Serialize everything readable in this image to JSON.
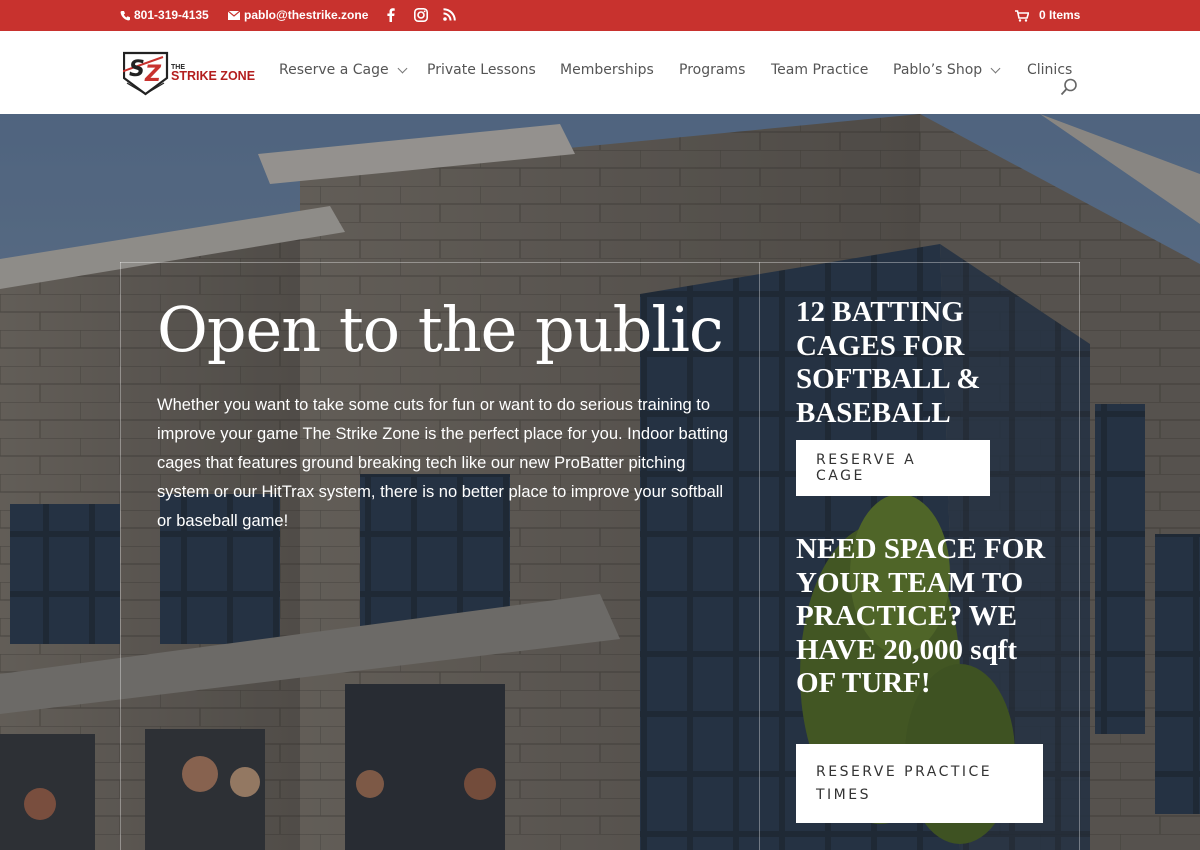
{
  "topbar": {
    "phone": "801-319-4135",
    "email": "pablo@thestrike.zone",
    "cart": "0 Items",
    "social_icons": [
      "facebook-icon",
      "instagram-icon",
      "rss-icon"
    ]
  },
  "logo": {
    "monogram": "SZ",
    "line1": "THE",
    "line2": "STRIKE ZONE"
  },
  "nav": {
    "items": [
      {
        "label": "Reserve a Cage",
        "dropdown": true
      },
      {
        "label": "Private Lessons",
        "dropdown": false
      },
      {
        "label": "Memberships",
        "dropdown": false
      },
      {
        "label": "Programs",
        "dropdown": false
      },
      {
        "label": "Team Practice",
        "dropdown": false
      },
      {
        "label": "Pablo’s Shop",
        "dropdown": true
      },
      {
        "label": "Clinics",
        "dropdown": false
      }
    ]
  },
  "hero": {
    "headline": "Open to the public",
    "body": "Whether you want to take some cuts for fun or want to do serious training to improve your game The Strike Zone is the perfect place for you. Indoor batting cages that features ground breaking tech like our new ProBatter pitching system or our HitTrax system, there is no better place to improve your softball or baseball game!",
    "right_heading_1": "12 BATTING CAGES FOR SOFTBALL & BASEBALL",
    "button_1": "RESERVE A CAGE",
    "right_heading_2": "NEED SPACE FOR YOUR TEAM TO PRACTICE? WE HAVE 20,000 sqft OF TURF!",
    "button_2": "RESERVE PRACTICE TIMES"
  },
  "colors": {
    "accent": "#c8322e",
    "nav_text": "#555555"
  }
}
